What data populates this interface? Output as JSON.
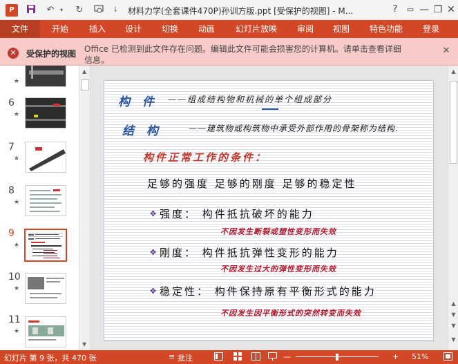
{
  "titlebar": {
    "app_icon": "P",
    "title": "材料力学(全套课件470P)孙训方版.ppt [受保护的视图] - M...",
    "help": "?",
    "minimize": "—",
    "restore": "❐",
    "close": "✕"
  },
  "ribbon": {
    "tabs": [
      "文件",
      "开始",
      "插入",
      "设计",
      "切换",
      "动画",
      "幻灯片放映",
      "审阅",
      "视图",
      "特色功能",
      "登录"
    ]
  },
  "protected_view": {
    "label": "受保护的视图",
    "message": "Office 已检测到此文件存在问题。编辑此文件可能会损害您的计算机。请单击查看详细信息。"
  },
  "thumbnails": [
    {
      "num": "",
      "star": "★"
    },
    {
      "num": "6",
      "star": "★"
    },
    {
      "num": "7",
      "star": "★"
    },
    {
      "num": "8",
      "star": "★"
    },
    {
      "num": "9",
      "star": "★"
    },
    {
      "num": "10",
      "star": "★"
    },
    {
      "num": "11",
      "star": "★"
    }
  ],
  "slide": {
    "term1": "构 件",
    "term1_def": "——组成结构物和机械的单个组成部分",
    "term2": "结 构",
    "term2_def": "——建筑物或构筑物中承受外部作用的骨架称为结构.",
    "condition_title": "构件正常工作的条件：",
    "three_reqs": "足够的强度   足够的刚度   足够的稳定性",
    "item1": "强度： 构件抵抗破坏的能力",
    "item1_note": "不因发生断裂或塑性变形而失效",
    "item2": "刚度： 构件抵抗弹性变形的能力",
    "item2_note": "不因发生过大的弹性变形而失效",
    "item3": "稳定性： 构件保持原有平衡形式的能力",
    "item3_note": "不因发生因平衡形式的突然转变而失效"
  },
  "status": {
    "slide_info": "幻灯片 第 9 张，共 470 张",
    "notes": "批注",
    "zoom": "51%"
  }
}
